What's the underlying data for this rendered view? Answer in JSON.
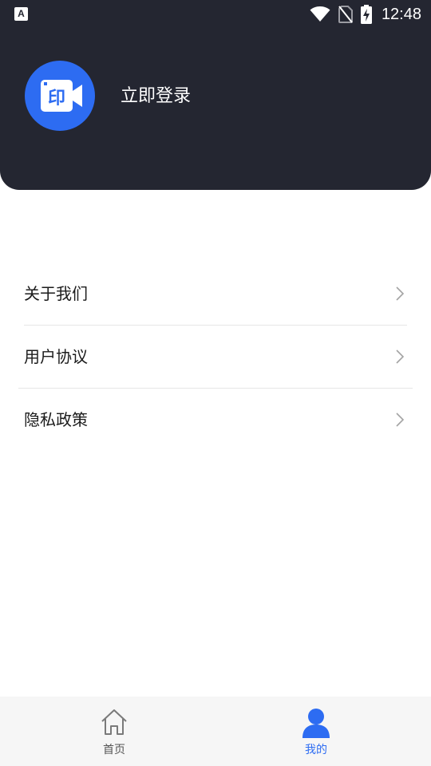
{
  "status_bar": {
    "time": "12:48",
    "app_icon_glyph": "A",
    "icons": [
      "wifi-icon",
      "no-sim-icon",
      "battery-charging-icon"
    ]
  },
  "profile": {
    "avatar_icon": "video-print-logo-icon",
    "avatar_glyph": "印",
    "login_label": "立即登录"
  },
  "menu": {
    "items": [
      {
        "label": "关于我们",
        "icon": "chevron-right-icon"
      },
      {
        "label": "用户协议",
        "icon": "chevron-right-icon"
      },
      {
        "label": "隐私政策",
        "icon": "chevron-right-icon"
      }
    ]
  },
  "tab_bar": {
    "tabs": [
      {
        "label": "首页",
        "icon": "home-icon",
        "active": false
      },
      {
        "label": "我的",
        "icon": "user-icon",
        "active": true
      }
    ],
    "active_color": "#2d6cf2",
    "inactive_color": "#555555"
  },
  "colors": {
    "header_bg": "#242631",
    "accent": "#2d6cf2"
  }
}
